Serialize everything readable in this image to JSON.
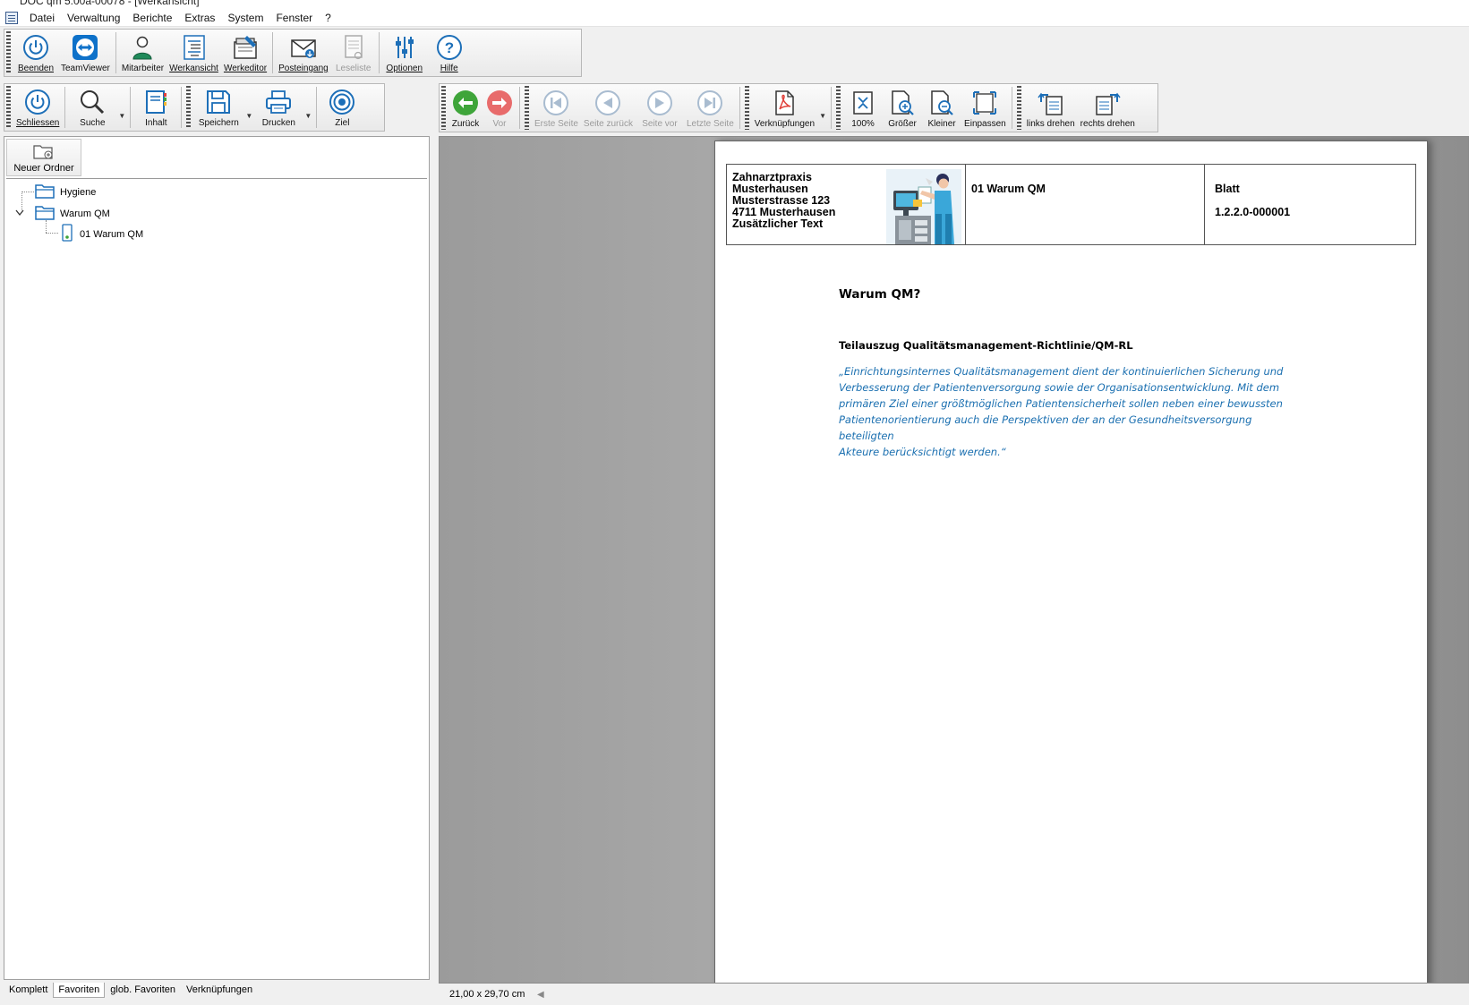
{
  "app": {
    "title": "DOC qm 5.00a-00078 - [Werkansicht]"
  },
  "menu": [
    "Datei",
    "Verwaltung",
    "Berichte",
    "Extras",
    "System",
    "Fenster",
    "?"
  ],
  "main_toolbar": {
    "beenden": "Beenden",
    "teamviewer": "TeamViewer",
    "mitarbeiter": "Mitarbeiter",
    "werkansicht": "Werkansicht",
    "werkeditor": "Werkeditor",
    "posteingang": "Posteingang",
    "leseliste": "Leseliste",
    "optionen": "Optionen",
    "hilfe": "Hilfe"
  },
  "doc_toolbar": {
    "schliessen": "Schliessen",
    "suche": "Suche",
    "inhalt": "Inhalt",
    "speichern": "Speichern",
    "drucken": "Drucken",
    "ziel": "Ziel"
  },
  "viewer_toolbar": {
    "zurueck": "Zurück",
    "vor": "Vor",
    "erste_seite": "Erste Seite",
    "seite_zurueck": "Seite zurück",
    "seite_vor": "Seite vor",
    "letzte_seite": "Letzte Seite",
    "verknuepfungen": "Verknüpfungen",
    "zoom100": "100%",
    "groesser": "Größer",
    "kleiner": "Kleiner",
    "einpassen": "Einpassen",
    "links_drehen": "links drehen",
    "rechts_drehen": "rechts drehen"
  },
  "left_panel": {
    "new_folder": "Neuer Ordner",
    "tree": {
      "hygiene": "Hygiene",
      "warum_qm": "Warum QM",
      "doc_01": "01 Warum QM"
    },
    "tabs": [
      "Komplett",
      "Favoriten",
      "glob. Favoriten",
      "Verknüpfungen"
    ],
    "active_tab": "Favoriten"
  },
  "document": {
    "header": {
      "org_line1": "Zahnarztpraxis",
      "org_line2": "Musterhausen",
      "org_line3": "Musterstrasse 123",
      "org_line4": "4711 Musterhausen",
      "org_line5": "Zusätzlicher Text",
      "doc_name": "01 Warum QM",
      "blatt_label": "Blatt",
      "blatt_number": "1.2.2.0-000001"
    },
    "title": "Warum QM?",
    "subtitle": "Teilauszug Qualitätsmanagement-Richtlinie/QM-RL",
    "quote_lines": [
      "„Einrichtungsinternes Qualitätsmanagement dient der kontinuierlichen Sicherung und",
      "Verbesserung der Patientenversorgung sowie der Organisationsentwicklung. Mit dem",
      "primären Ziel einer größtmöglichen Patientensicherheit sollen neben einer bewussten",
      "Patientenorientierung auch die Perspektiven der an der Gesundheitsversorgung beteiligten",
      "Akteure berücksichtigt werden.“"
    ]
  },
  "status": {
    "page_size": "21,00 x 29,70 cm"
  },
  "colors": {
    "accent_blue": "#1a6fb0",
    "back_green": "#3fa53a",
    "forward_red": "#e86b6b"
  }
}
